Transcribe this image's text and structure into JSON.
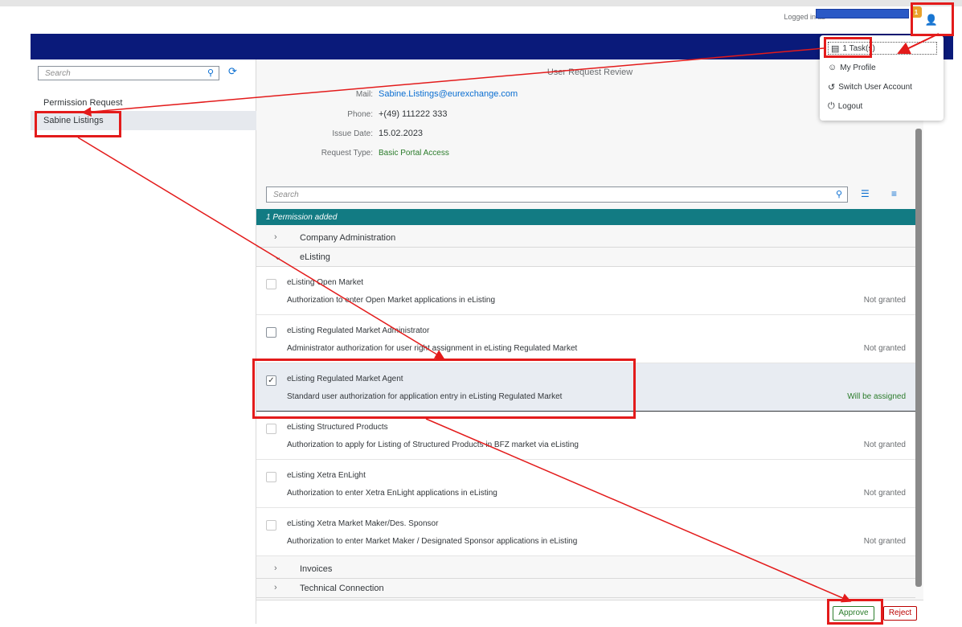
{
  "header": {
    "logged_in_label": "Logged in as",
    "task_badge": "1"
  },
  "sidebar": {
    "search_placeholder": "Search",
    "section_title": "Permission Request",
    "items": [
      {
        "label": "Sabine Listings"
      }
    ]
  },
  "main": {
    "title": "User Request Review",
    "fields": {
      "mail_label": "Mail:",
      "mail_value": "Sabine.Listings@eurexchange.com",
      "phone_label": "Phone:",
      "phone_value": "+(49) 111222 333",
      "issue_label": "Issue Date:",
      "issue_value": "15.02.2023",
      "type_label": "Request Type:",
      "type_value": "Basic Portal Access"
    },
    "list_search_placeholder": "Search",
    "permission_band": "1 Permission added",
    "groups": [
      {
        "label": "Company Administration"
      },
      {
        "label": "eListing"
      },
      {
        "label": "Invoices"
      },
      {
        "label": "Technical Connection"
      }
    ],
    "items": [
      {
        "title": "eListing Open Market",
        "desc": "Authorization to enter Open Market applications in eListing",
        "status": "Not granted",
        "checked": false
      },
      {
        "title": "eListing Regulated Market Administrator",
        "desc": "Administrator authorization for user right assignment in eListing Regulated Market",
        "status": "Not granted",
        "checked": false
      },
      {
        "title": "eListing Regulated Market Agent",
        "desc": "Standard user authorization for application entry in eListing Regulated Market",
        "status": "Will be assigned",
        "checked": true
      },
      {
        "title": "eListing Structured Products",
        "desc": "Authorization to apply for Listing of Structured Products in BFZ market via eListing",
        "status": "Not granted",
        "checked": false
      },
      {
        "title": "eListing Xetra EnLight",
        "desc": "Authorization to enter Xetra EnLight applications in eListing",
        "status": "Not granted",
        "checked": false
      },
      {
        "title": "eListing Xetra Market Maker/Des. Sponsor",
        "desc": "Authorization to enter Market Maker / Designated Sponsor applications in eListing",
        "status": "Not granted",
        "checked": false
      }
    ],
    "approve_label": "Approve",
    "reject_label": "Reject"
  },
  "user_menu": {
    "tasks": "1 Task(s)",
    "profile": "My Profile",
    "switch": "Switch User Account",
    "logout": "Logout"
  },
  "colors": {
    "accent": "#0a6ed1",
    "nav_bar": "#0a1a7a",
    "band": "#127b83",
    "annotation": "#e31b1b"
  }
}
